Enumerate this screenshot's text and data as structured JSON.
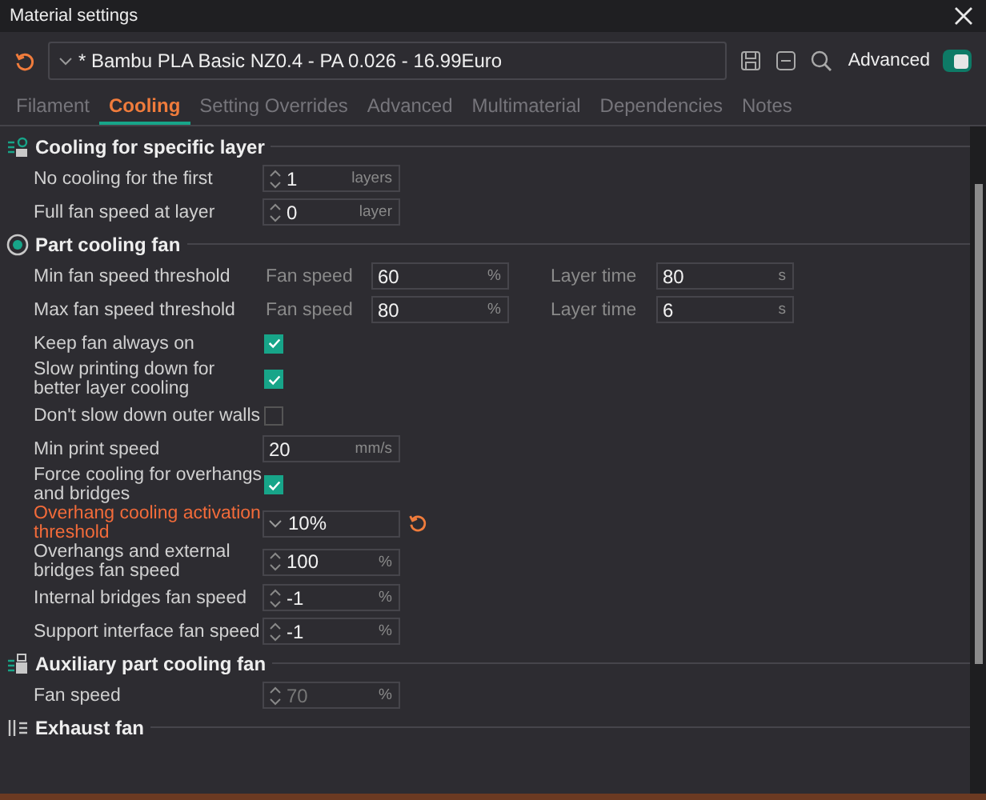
{
  "window": {
    "title": "Material settings"
  },
  "preset": {
    "name": "* Bambu PLA Basic NZ0.4 - PA 0.026 - 16.99Euro"
  },
  "advanced": {
    "label": "Advanced",
    "on": true
  },
  "tabs": [
    {
      "label": "Filament",
      "selected": false
    },
    {
      "label": "Cooling",
      "selected": true
    },
    {
      "label": "Setting Overrides",
      "selected": false
    },
    {
      "label": "Advanced",
      "selected": false
    },
    {
      "label": "Multimaterial",
      "selected": false
    },
    {
      "label": "Dependencies",
      "selected": false
    },
    {
      "label": "Notes",
      "selected": false
    }
  ],
  "sections": [
    {
      "title": "Cooling for specific layer",
      "rows": [
        {
          "kind": "field",
          "label": "No cooling for the first",
          "value": "1",
          "unit": "layers",
          "spinner": true,
          "disabled": false,
          "modified": false
        },
        {
          "kind": "field",
          "label": "Full fan speed at layer",
          "value": "0",
          "unit": "layer",
          "spinner": true,
          "disabled": false,
          "modified": false
        }
      ]
    },
    {
      "title": "Part cooling fan",
      "rows": [
        {
          "kind": "pair",
          "label": "Min fan speed threshold",
          "modified": false,
          "fields": [
            {
              "caption": "Fan speed",
              "value": "60",
              "unit": "%"
            },
            {
              "caption": "Layer time",
              "value": "80",
              "unit": "s"
            }
          ]
        },
        {
          "kind": "pair",
          "label": "Max fan speed threshold",
          "modified": false,
          "fields": [
            {
              "caption": "Fan speed",
              "value": "80",
              "unit": "%"
            },
            {
              "caption": "Layer time",
              "value": "6",
              "unit": "s"
            }
          ]
        },
        {
          "kind": "check",
          "label": "Keep fan always on",
          "checked": true,
          "modified": false
        },
        {
          "kind": "check",
          "label": "Slow printing down for better layer cooling",
          "checked": true,
          "modified": false
        },
        {
          "kind": "check",
          "label": "Don't slow down outer walls",
          "checked": false,
          "modified": false
        },
        {
          "kind": "field",
          "label": "Min print speed",
          "value": "20",
          "unit": "mm/s",
          "spinner": false,
          "disabled": false,
          "modified": false
        },
        {
          "kind": "check",
          "label": "Force cooling for overhangs and bridges",
          "checked": true,
          "modified": false
        },
        {
          "kind": "dropdown",
          "label": "Overhang cooling activation threshold",
          "value": "10%",
          "modified": true
        },
        {
          "kind": "field",
          "label": "Overhangs and external bridges fan speed",
          "value": "100",
          "unit": "%",
          "spinner": true,
          "disabled": false,
          "modified": false
        },
        {
          "kind": "field",
          "label": "Internal bridges fan speed",
          "value": "-1",
          "unit": "%",
          "spinner": true,
          "disabled": false,
          "modified": false
        },
        {
          "kind": "field",
          "label": "Support interface fan speed",
          "value": "-1",
          "unit": "%",
          "spinner": true,
          "disabled": false,
          "modified": false
        }
      ]
    },
    {
      "title": "Auxiliary part cooling fan",
      "rows": [
        {
          "kind": "field",
          "label": "Fan speed",
          "value": "70",
          "unit": "%",
          "spinner": true,
          "disabled": true,
          "modified": false
        }
      ]
    },
    {
      "title": "Exhaust fan"
    }
  ]
}
